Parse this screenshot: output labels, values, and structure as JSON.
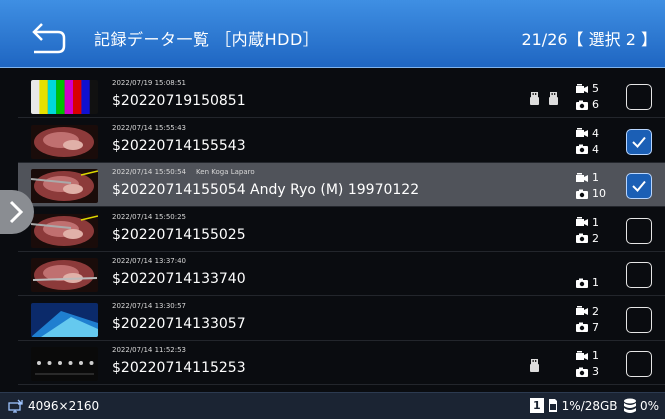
{
  "header": {
    "back_icon": "back-arrow-icon",
    "title": "記録データ一覧 ［内蔵HDD］",
    "count": "21/26【 選択 2 】"
  },
  "records": [
    {
      "date": "2022/07/19 15:08:51",
      "meta": "",
      "id": "$20220719150851",
      "usb": 2,
      "videos": "5",
      "photos": "6",
      "checked": false,
      "active": false,
      "thumb": "color-bars"
    },
    {
      "date": "2022/07/14 15:55:43",
      "meta": "",
      "id": "$20220714155543",
      "usb": 0,
      "videos": "4",
      "photos": "4",
      "checked": true,
      "active": false,
      "thumb": "surgery"
    },
    {
      "date": "2022/07/14 15:50:54",
      "meta": "Ken Koga  Laparo",
      "id": "$20220714155054 Andy Ryo (M) 19970122",
      "usb": 0,
      "videos": "1",
      "photos": "10",
      "checked": true,
      "active": true,
      "thumb": "surgery-instrument"
    },
    {
      "date": "2022/07/14 15:50:25",
      "meta": "",
      "id": "$20220714155025",
      "usb": 0,
      "videos": "1",
      "photos": "2",
      "checked": false,
      "active": false,
      "thumb": "surgery-instrument"
    },
    {
      "date": "2022/07/14 13:37:40",
      "meta": "",
      "id": "$20220714133740",
      "usb": 0,
      "videos": "",
      "photos": "1",
      "checked": false,
      "active": false,
      "thumb": "surgery-flat"
    },
    {
      "date": "2022/07/14 13:30:57",
      "meta": "",
      "id": "$20220714133057",
      "usb": 0,
      "videos": "2",
      "photos": "7",
      "checked": false,
      "active": false,
      "thumb": "blue-scene"
    },
    {
      "date": "2022/07/14 11:52:53",
      "meta": "",
      "id": "$20220714115253",
      "usb": 1,
      "videos": "1",
      "photos": "3",
      "checked": false,
      "active": false,
      "thumb": "dark-menu"
    }
  ],
  "footer": {
    "resolution": "4096×2160",
    "slot": "1",
    "storage": "1%/28GB",
    "disk_usage": "0%"
  },
  "colors": {
    "header_top": "#3f8fe3",
    "header_bottom": "#1f66c2",
    "checked_fill": "#1b5fb5",
    "active_row": "#50535a",
    "footer_bg": "#1b2433"
  }
}
